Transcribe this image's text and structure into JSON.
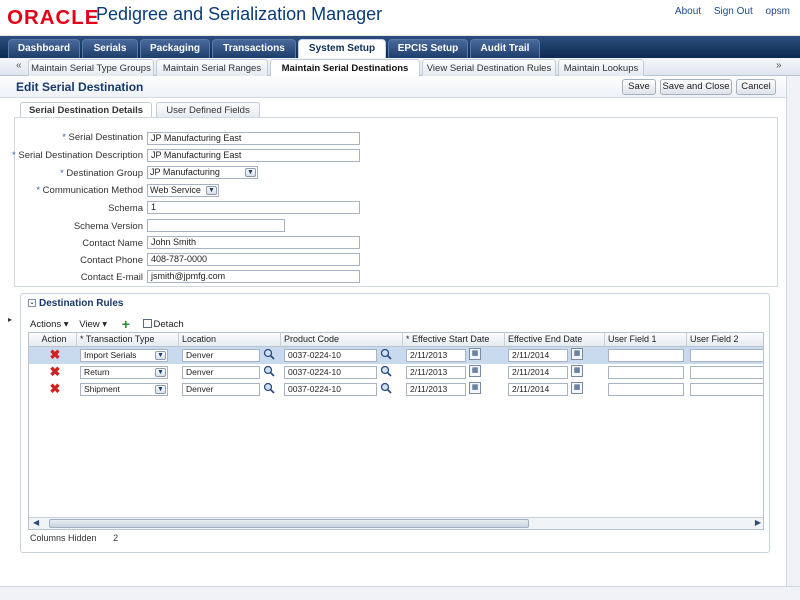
{
  "header": {
    "logo": "ORACLE",
    "app_title": "Pedigree and Serialization Manager",
    "links": [
      "About",
      "Sign Out",
      "opsm"
    ]
  },
  "main_tabs": [
    "Dashboard",
    "Serials",
    "Packaging",
    "Transactions",
    "System Setup",
    "EPCIS Setup",
    "Audit Trail"
  ],
  "sub_tabs": [
    "Maintain Serial Type Groups",
    "Maintain Serial Ranges",
    "Maintain Serial Destinations",
    "View Serial Destination Rules",
    "Maintain Lookups"
  ],
  "page": {
    "title": "Edit Serial Destination",
    "buttons": {
      "save": "Save",
      "save_close": "Save and Close",
      "cancel": "Cancel"
    }
  },
  "detail_tabs": [
    "Serial Destination Details",
    "User Defined Fields"
  ],
  "form": {
    "serial_destination": {
      "label": "Serial Destination",
      "value": "JP Manufacturing East",
      "required": "*"
    },
    "description": {
      "label": "Serial Destination Description",
      "value": "JP Manufacturing East",
      "required": "*"
    },
    "destination_group": {
      "label": "Destination Group",
      "value": "JP Manufacturing",
      "required": "*"
    },
    "communication_method": {
      "label": "Communication Method",
      "value": "Web Service",
      "required": "*"
    },
    "schema": {
      "label": "Schema",
      "value": "1"
    },
    "schema_version": {
      "label": "Schema Version",
      "value": ""
    },
    "contact_name": {
      "label": "Contact Name",
      "value": "John Smith"
    },
    "contact_phone": {
      "label": "Contact Phone",
      "value": "408-787-0000"
    },
    "contact_email": {
      "label": "Contact E-mail",
      "value": "jsmith@jpmfg.com"
    }
  },
  "rules": {
    "title": "Destination Rules",
    "actions_label": "Actions",
    "view_label": "View",
    "detach_label": "Detach",
    "columns": [
      "Action",
      "* Transaction Type",
      "Location",
      "Product Code",
      "* Effective Start Date",
      "Effective End Date",
      "User Field 1",
      "User Field 2"
    ],
    "rows": [
      {
        "type": "Import Serials",
        "location": "Denver",
        "product": "0037-0224-10",
        "start": "2/11/2013",
        "end": "2/11/2014"
      },
      {
        "type": "Return",
        "location": "Denver",
        "product": "0037-0224-10",
        "start": "2/11/2013",
        "end": "2/11/2014"
      },
      {
        "type": "Shipment",
        "location": "Denver",
        "product": "0037-0224-10",
        "start": "2/11/2013",
        "end": "2/11/2014"
      }
    ],
    "columns_hidden_label": "Columns Hidden",
    "columns_hidden_value": "2"
  }
}
